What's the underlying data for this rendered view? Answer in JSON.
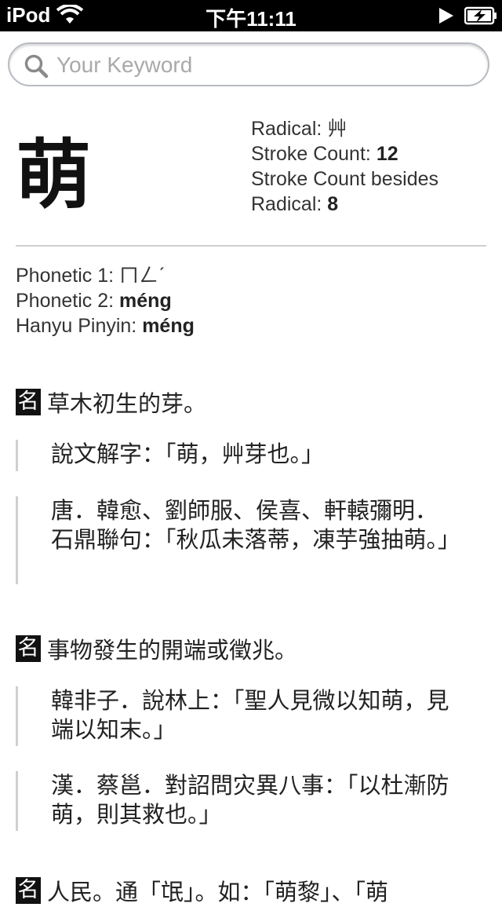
{
  "status_bar": {
    "carrier": "iPod",
    "time": "下午11:11"
  },
  "search": {
    "placeholder": "Your Keyword",
    "value": ""
  },
  "character": {
    "glyph": "萌",
    "radical_label": "Radical:",
    "radical": "艸",
    "stroke_count_label": "Stroke Count:",
    "stroke_count": "12",
    "stroke_besides_label_1": "Stroke Count besides",
    "stroke_besides_label_2": "Radical:",
    "stroke_besides": "8"
  },
  "phonetics": {
    "phonetic1_label": "Phonetic 1:",
    "phonetic1": "ㄇㄥˊ",
    "phonetic2_label": "Phonetic 2:",
    "phonetic2": "méng",
    "pinyin_label": "Hanyu Pinyin:",
    "pinyin": "méng"
  },
  "definitions": [
    {
      "pos": "名",
      "text": "草木初生的芽。",
      "quotes": [
        "說文解字：「萌，艸芽也。」",
        "唐．韓愈、劉師服、侯喜、軒轅彌明．石鼎聯句：「秋瓜未落蒂，凍芋強抽萌。」"
      ]
    },
    {
      "pos": "名",
      "text": "事物發生的開端或徵兆。",
      "quotes": [
        "韓非子．說林上：「聖人見微以知萌，見端以知末。」",
        "漢．蔡邕．對詔問灾異八事：「以杜漸防萌，則其救也。」"
      ]
    },
    {
      "pos": "名",
      "text": "人民。通「氓」。如：「萌黎」、「萌",
      "quotes": []
    }
  ]
}
